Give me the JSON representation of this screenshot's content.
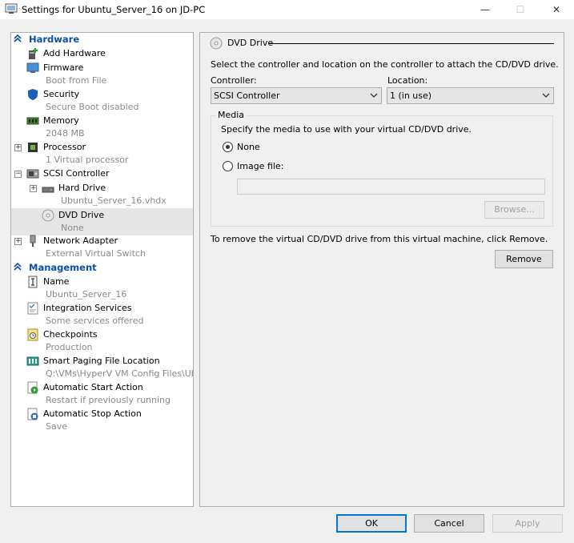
{
  "window": {
    "title": "Settings for Ubuntu_Server_16 on JD-PC",
    "min_glyph": "—",
    "max_glyph": "☐",
    "close_glyph": "✕"
  },
  "tree": {
    "hardware_header": "Hardware",
    "management_header": "Management",
    "hardware_items": [
      {
        "label": "Add Hardware",
        "sub": ""
      },
      {
        "label": "Firmware",
        "sub": "Boot from File"
      },
      {
        "label": "Security",
        "sub": "Secure Boot disabled"
      },
      {
        "label": "Memory",
        "sub": "2048 MB"
      },
      {
        "label": "Processor",
        "sub": "1 Virtual processor"
      },
      {
        "label": "SCSI Controller",
        "sub": ""
      },
      {
        "label": "Hard Drive",
        "sub": "Ubuntu_Server_16.vhdx"
      },
      {
        "label": "DVD Drive",
        "sub": "None"
      },
      {
        "label": "Network Adapter",
        "sub": "External Virtual Switch"
      }
    ],
    "management_items": [
      {
        "label": "Name",
        "sub": "Ubuntu_Server_16"
      },
      {
        "label": "Integration Services",
        "sub": "Some services offered"
      },
      {
        "label": "Checkpoints",
        "sub": "Production"
      },
      {
        "label": "Smart Paging File Location",
        "sub": "Q:\\VMs\\HyperV VM Config Files\\Ub..."
      },
      {
        "label": "Automatic Start Action",
        "sub": "Restart if previously running"
      },
      {
        "label": "Automatic Stop Action",
        "sub": "Save"
      }
    ],
    "expander_plus": "+",
    "expander_minus": "−"
  },
  "panel": {
    "header": "DVD Drive",
    "instruction": "Select the controller and location on the controller to attach the CD/DVD drive.",
    "controller_label": "Controller:",
    "controller_value": "SCSI Controller",
    "location_label": "Location:",
    "location_value": "1 (in use)",
    "media_label": "Media",
    "media_instruction": "Specify the media to use with your virtual CD/DVD drive.",
    "none_label": "None",
    "image_file_label": "Image file:",
    "image_file_value": "",
    "browse_label": "Browse...",
    "remove_text": "To remove the virtual CD/DVD drive from this virtual machine, click Remove.",
    "remove_label": "Remove"
  },
  "footer": {
    "ok_label": "OK",
    "cancel_label": "Cancel",
    "apply_label": "Apply"
  },
  "colors": {
    "section_header": "#0a50a3",
    "selection": "#e6e6e6",
    "focus_border": "#0078d7"
  }
}
